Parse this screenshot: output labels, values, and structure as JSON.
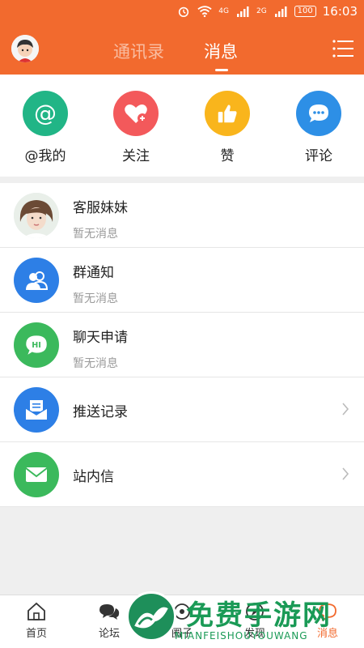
{
  "status_bar": {
    "signal_left": "4G",
    "signal_right": "2G",
    "battery": "100",
    "time": "16:03"
  },
  "header": {
    "tabs": [
      {
        "label": "通讯录",
        "active": false
      },
      {
        "label": "消息",
        "active": true
      }
    ],
    "avatar_icon": "user-avatar-icon",
    "menu_icon": "menu-list-icon"
  },
  "quick_actions": [
    {
      "label": "@我的",
      "icon": "at-icon",
      "color": "#21b586"
    },
    {
      "label": "关注",
      "icon": "heart-plus-icon",
      "color": "#f3595b"
    },
    {
      "label": "赞",
      "icon": "thumbs-up-icon",
      "color": "#f9b51c"
    },
    {
      "label": "评论",
      "icon": "comment-icon",
      "color": "#2d8fe6"
    }
  ],
  "messages": [
    {
      "title": "客服妹妹",
      "subtitle": "暂无消息",
      "icon": "support-avatar-icon"
    },
    {
      "title": "群通知",
      "subtitle": "暂无消息",
      "icon": "group-icon",
      "color": "#2d7fe6"
    },
    {
      "title": "聊天申请",
      "subtitle": "暂无消息",
      "icon": "chat-hi-icon",
      "color": "#3bb95c"
    },
    {
      "title": "推送记录",
      "icon": "push-record-icon",
      "color": "#2d7fe6"
    },
    {
      "title": "站内信",
      "icon": "mail-icon",
      "color": "#3bb95c"
    }
  ],
  "bottom_nav": [
    {
      "label": "首页",
      "icon": "home-icon"
    },
    {
      "label": "论坛",
      "icon": "forum-icon"
    },
    {
      "label": "圈子",
      "icon": "circle-icon"
    },
    {
      "label": "发现",
      "icon": "compass-icon"
    },
    {
      "label": "消息",
      "icon": "message-icon",
      "active": true
    }
  ],
  "watermark": {
    "title": "免费手游网",
    "subtitle": "MIANFEISHOUYOUWANG"
  },
  "colors": {
    "brand": "#f26a2e",
    "background": "#efefef"
  }
}
